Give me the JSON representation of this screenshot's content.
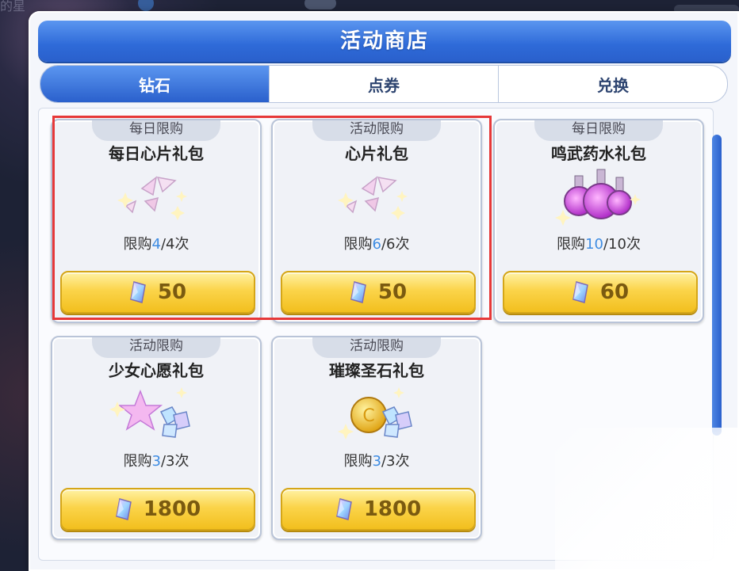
{
  "window": {
    "title": "活动商店"
  },
  "background": {
    "text": "的星"
  },
  "tabs": [
    {
      "label": "钻石",
      "active": true
    },
    {
      "label": "点券",
      "active": false
    },
    {
      "label": "兑换",
      "active": false
    }
  ],
  "items": [
    {
      "tag": "每日限购",
      "name": "每日心片礼包",
      "limit_prefix": "限购",
      "limit_current": "4",
      "limit_total": "/4次",
      "price": "50",
      "icon": "heart-shards-icon"
    },
    {
      "tag": "活动限购",
      "name": "心片礼包",
      "limit_prefix": "限购",
      "limit_current": "6",
      "limit_total": "/6次",
      "price": "50",
      "icon": "heart-shards-icon"
    },
    {
      "tag": "每日限购",
      "name": "鸣武药水礼包",
      "limit_prefix": "限购",
      "limit_current": "10",
      "limit_total": "/10次",
      "price": "60",
      "icon": "potion-bottles-icon"
    },
    {
      "tag": "活动限购",
      "name": "少女心愿礼包",
      "limit_prefix": "限购",
      "limit_current": "3",
      "limit_total": "/3次",
      "price": "1800",
      "icon": "star-crystal-icon"
    },
    {
      "tag": "活动限购",
      "name": "璀璨圣石礼包",
      "limit_prefix": "限购",
      "limit_current": "3",
      "limit_total": "/3次",
      "price": "1800",
      "icon": "gold-coin-crystal-icon"
    }
  ],
  "colors": {
    "accent": "#2e6ad8",
    "button": "#fbd44a",
    "highlight": "#e63838",
    "limit_current": "#3e8ce2"
  }
}
